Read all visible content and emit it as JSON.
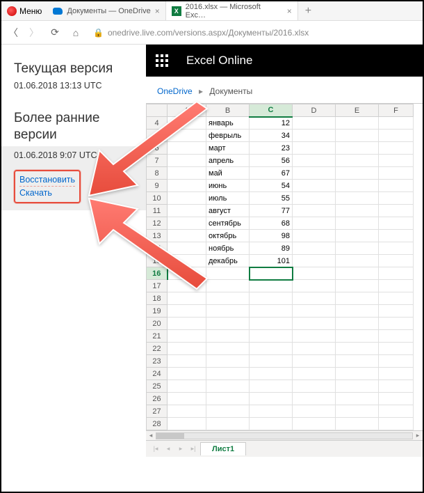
{
  "browser": {
    "menu_label": "Меню",
    "tabs": [
      {
        "label": "Документы — OneDrive",
        "icon": "onedrive"
      },
      {
        "label": "2016.xlsx — Microsoft Exc…",
        "icon": "excel"
      }
    ],
    "url_host": "onedrive.live.com",
    "url_path": "/versions.aspx/Документы/2016.xlsx"
  },
  "sidebar": {
    "current_heading": "Текущая версия",
    "current_ts": "01.06.2018 13:13 UTC",
    "older_heading": "Более ранние версии",
    "older_ts": "01.06.2018 9:07 UTC",
    "restore_label": "Восстановить",
    "download_label": "Скачать"
  },
  "header": {
    "app_name": "Excel Online"
  },
  "breadcrumb": {
    "root": "OneDrive",
    "folder": "Документы"
  },
  "sheet_tab": "Лист1",
  "chart_data": {
    "type": "table",
    "columns": [
      "A",
      "B",
      "C",
      "D",
      "E",
      "F"
    ],
    "active_column": "C",
    "active_row": 16,
    "row_start": 4,
    "row_end": 28,
    "rows": [
      {
        "r": 4,
        "B": "январь",
        "C": 12
      },
      {
        "r": 5,
        "B": "феврыль",
        "C": 34
      },
      {
        "r": 6,
        "B": "март",
        "C": 23
      },
      {
        "r": 7,
        "B": "апрель",
        "C": 56
      },
      {
        "r": 8,
        "B": "май",
        "C": 67
      },
      {
        "r": 9,
        "B": "июнь",
        "C": 54
      },
      {
        "r": 10,
        "B": "июль",
        "C": 55
      },
      {
        "r": 11,
        "B": "август",
        "C": 77
      },
      {
        "r": 12,
        "B": "сентябрь",
        "C": 68
      },
      {
        "r": 13,
        "B": "октябрь",
        "C": 98
      },
      {
        "r": 14,
        "B": "ноябрь",
        "C": 89
      },
      {
        "r": 15,
        "B": "декабрь",
        "C": 101
      }
    ]
  }
}
